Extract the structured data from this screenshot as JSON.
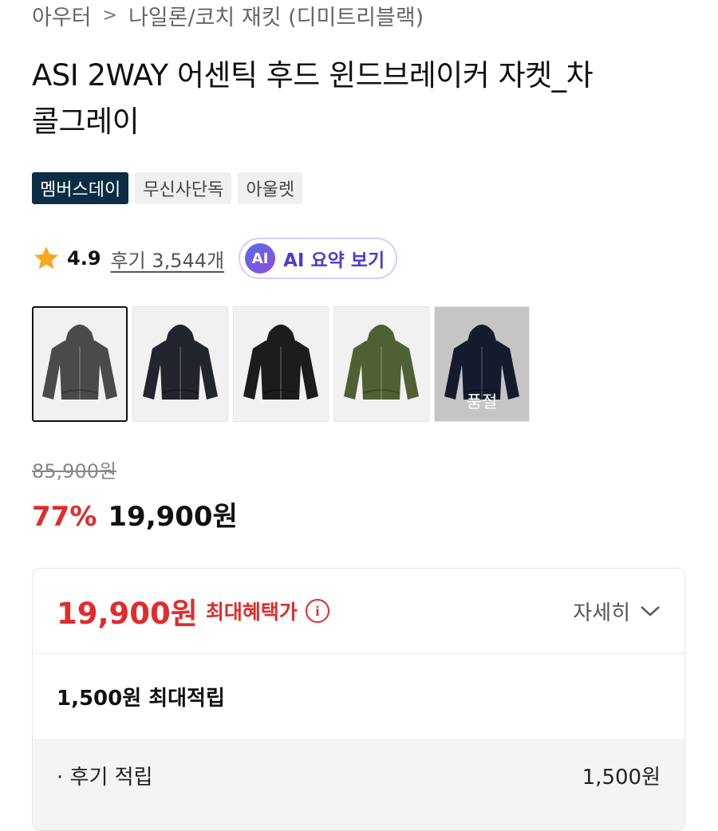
{
  "breadcrumb": {
    "root": "아우터",
    "leaf": "나일론/코치 재킷 (디미트리블랙)"
  },
  "product": {
    "title_line1": "ASI 2WAY 어센틱 후드 윈드브레이커 자켓_차",
    "title_line2": "콜그레이"
  },
  "badges": [
    "멤버스데이",
    "무신사단독",
    "아울렛"
  ],
  "rating": {
    "score": "4.9",
    "reviews_label": "후기 3,544개",
    "ai_icon": "AI",
    "ai_button": "AI 요약 보기"
  },
  "thumbnails": [
    {
      "color": "#4a4a4a",
      "selected": true,
      "soldout_label": ""
    },
    {
      "color": "#22252d",
      "selected": false,
      "soldout_label": ""
    },
    {
      "color": "#1c1c1c",
      "selected": false,
      "soldout_label": ""
    },
    {
      "color": "#4f6134",
      "selected": false,
      "soldout_label": ""
    },
    {
      "color": "#1a2238",
      "selected": false,
      "soldout_label": "품절"
    }
  ],
  "price": {
    "original": "85,900원",
    "discount": "77%",
    "sale": "19,900원"
  },
  "benefit": {
    "price": "19,900원",
    "label": "최대혜택가",
    "info_icon": "i",
    "detail_label": "자세히",
    "points_label": "1,500원 최대적립",
    "review_points_label": "· 후기 적립",
    "review_points_value": "1,500원"
  },
  "colors": {
    "accent_red": "#e02c2c",
    "badge_navy": "#0b2d45",
    "ai_purple": "#4c3ad1"
  }
}
